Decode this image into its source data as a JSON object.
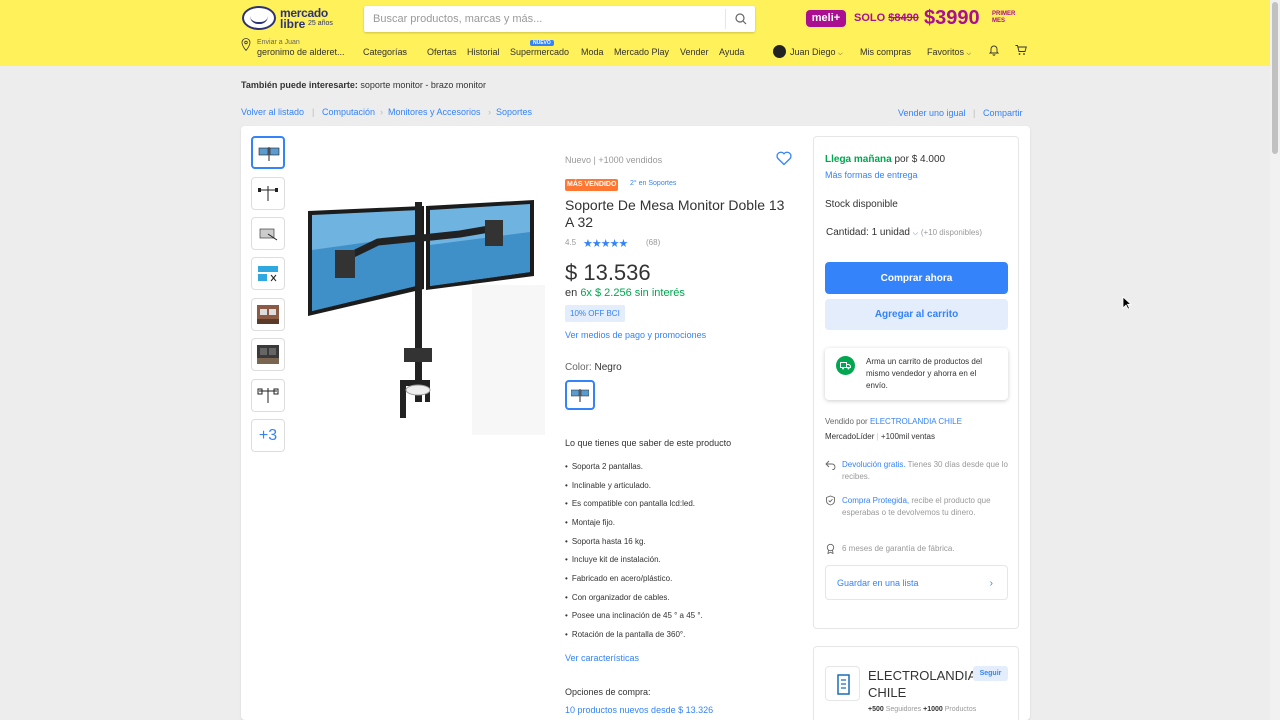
{
  "header": {
    "logo_line1": "mercado",
    "logo_line2": "libre",
    "logo_years": "25 años",
    "search_placeholder": "Buscar productos, marcas y más...",
    "promo": {
      "badge": "meli+",
      "solo": "SOLO",
      "old_price": "$8490",
      "price": "$3990",
      "per_month": "PRIMER MES"
    },
    "location": {
      "line1": "Enviar a Juan",
      "line2": "geronimo de alderet..."
    },
    "nav": [
      "Categorías",
      "Ofertas",
      "Historial",
      "Supermercado",
      "Moda",
      "Mercado Play",
      "Vender",
      "Ayuda"
    ],
    "nav_badge": "NUEVO",
    "user": {
      "name": "Juan Diego",
      "compras": "Mis compras",
      "favoritos": "Favoritos"
    }
  },
  "suggest": {
    "label": "También puede interesarte:",
    "terms": "soporte monitor - brazo monitor"
  },
  "breadcrumb": {
    "back": "Volver al listado",
    "items": [
      "Computación",
      "Monitores y Accesorios",
      "Soportes"
    ],
    "sell_same": "Vender uno igual",
    "share": "Compartir"
  },
  "gallery": {
    "more": "+3"
  },
  "product": {
    "condition": "Nuevo  |  +1000 vendidos",
    "badge": "MÁS VENDIDO",
    "badge_link": "2° en Soportes",
    "title": "Soporte De Mesa Monitor Doble 13 A 32",
    "rating": "4.5",
    "stars": "★★★★★",
    "reviews": "(68)",
    "price": "$ 13.536",
    "installments_prefix": "en",
    "installments": "6x $ 2.256 sin interés",
    "discount": "10% OFF BCI",
    "payment_link": "Ver medios de pago y promociones",
    "color_label": "Color:",
    "color_value": "Negro",
    "features_title": "Lo que tienes que saber de este producto",
    "features": [
      "Soporta 2 pantallas.",
      "Inclinable y articulado.",
      "Es compatible con pantalla lcd:led.",
      "Montaje fijo.",
      "Soporta hasta 16 kg.",
      "Incluye kit de instalación.",
      "Fabricado en acero/plástico.",
      "Con organizador de cables.",
      "Posee una inclinación de 45 ° a 45 °.",
      "Rotación de la pantalla de 360°."
    ],
    "features_link": "Ver características",
    "buy_options": "Opciones de compra:",
    "new_products": "10 productos nuevos desde $ 13.326"
  },
  "buybox": {
    "delivery_green": "Llega mañana",
    "delivery_rest": "por $ 4.000",
    "more_delivery": "Más formas de entrega",
    "stock": "Stock disponible",
    "quantity_label": "Cantidad:",
    "quantity_value": "1 unidad",
    "available": "(+10 disponibles)",
    "buy_now": "Comprar ahora",
    "add_cart": "Agregar al carrito",
    "tip": "Arma un carrito de productos del mismo vendedor y ahorra en el envío.",
    "sold_by_label": "Vendido por",
    "seller": "ELECTROLANDIA CHILE",
    "leader": "MercadoLíder",
    "sales": "+100mil ventas",
    "return_link": "Devolución gratis.",
    "return_text": "Tienes 30 días desde que lo recibes.",
    "protect_link": "Compra Protegida,",
    "protect_text": "recibe el producto que esperabas o te devolvemos tu dinero.",
    "warranty": "6 meses de garantía de fábrica.",
    "save_list": "Guardar en una lista"
  },
  "seller_card": {
    "name": "ELECTROLANDIA CHILE",
    "follow": "Seguir",
    "followers_num": "+500",
    "followers_label": "Seguidores",
    "products_num": "+1000",
    "products_label": "Productos"
  },
  "colors": {
    "header_yellow": "#fff159",
    "primary_blue": "#3483fa",
    "green": "#00a650",
    "meli_purple": "#a90f90",
    "badge_orange": "#ff7733"
  }
}
